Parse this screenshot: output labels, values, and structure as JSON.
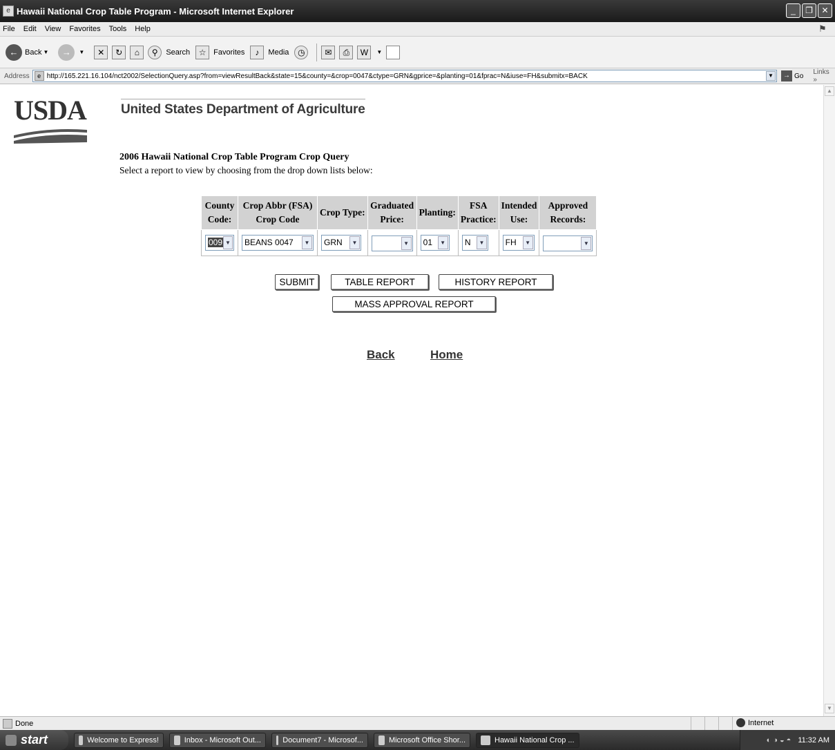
{
  "window": {
    "title": "Hawaii National Crop Table Program - Microsoft Internet Explorer",
    "buttons": [
      "_",
      "❐",
      "✕"
    ]
  },
  "menu": [
    "File",
    "Edit",
    "View",
    "Favorites",
    "Tools",
    "Help"
  ],
  "toolbar": {
    "back": "Back",
    "search": "Search",
    "favorites": "Favorites",
    "media": "Media"
  },
  "address": {
    "label": "Address",
    "url": "http://165.221.16.104/nct2002/SelectionQuery.asp?from=viewResultBack&state=15&county=&crop=0047&ctype=GRN&gprice=&planting=01&fprac=N&iuse=FH&submitx=BACK",
    "go": "Go",
    "links": "Links"
  },
  "page": {
    "logo_text": "USDA",
    "dept_title": "United States Department of Agriculture",
    "query_title": "2006 Hawaii National Crop Table Program Crop Query",
    "query_subtitle": "Select a report to view by choosing from the drop down lists below:",
    "columns": [
      {
        "line1": "County",
        "line2": "Code:",
        "value": "009"
      },
      {
        "line1": "Crop Abbr (FSA)",
        "line2": "Crop Code",
        "value": "BEANS 0047"
      },
      {
        "line1": "Crop Type:",
        "line2": "",
        "value": "GRN"
      },
      {
        "line1": "Graduated",
        "line2": "Price:",
        "value": ""
      },
      {
        "line1": "Planting:",
        "line2": "",
        "value": "01"
      },
      {
        "line1": "FSA",
        "line2": "Practice:",
        "value": "N"
      },
      {
        "line1": "Intended",
        "line2": "Use:",
        "value": "FH"
      },
      {
        "line1": "Approved",
        "line2": "Records:",
        "value": ""
      }
    ],
    "buttons": {
      "submit": "SUBMIT",
      "table_report": "TABLE REPORT",
      "history_report": "HISTORY REPORT",
      "mass_approval": "MASS APPROVAL REPORT"
    },
    "links": {
      "back": "Back",
      "home": "Home"
    }
  },
  "status": {
    "text": "Done",
    "zone": "Internet"
  },
  "taskbar": {
    "start": "start",
    "tasks": [
      "Welcome to Express!",
      "Inbox - Microsoft Out...",
      "Document7 - Microsof...",
      "Microsoft Office Shor...",
      "Hawaii National Crop ..."
    ],
    "clock": "11:32 AM"
  }
}
